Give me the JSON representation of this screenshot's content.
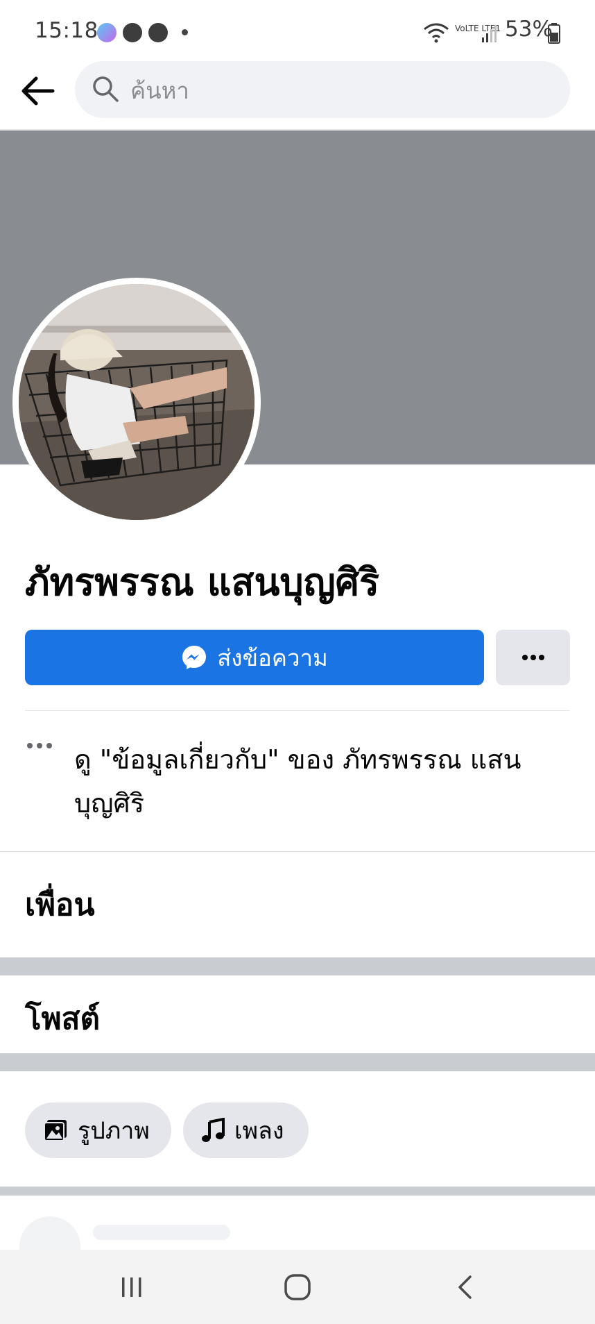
{
  "status_bar": {
    "time": "15:18",
    "battery": "53%",
    "notification_icons": [
      "messenger-icon",
      "line-icon",
      "z-icon"
    ],
    "network": "VoLTE LTE1"
  },
  "search": {
    "placeholder": "ค้นหา"
  },
  "profile": {
    "name": "ภัทรพรรณ แสนบุญศิริ",
    "message_button": "ส่งข้อความ",
    "about_text": "ดู \"ข้อมูลเกี่ยวกับ\" ของ ภัทรพรรณ แสนบุญศิริ"
  },
  "sections": {
    "friends": "เพื่อน",
    "posts": "โพสต์"
  },
  "chips": [
    {
      "label": "รูปภาพ",
      "icon": "photos-icon"
    },
    {
      "label": "เพลง",
      "icon": "music-icon"
    }
  ],
  "colors": {
    "accent": "#1b74e4",
    "cover": "#898c90",
    "chip_bg": "#e4e6eb"
  }
}
